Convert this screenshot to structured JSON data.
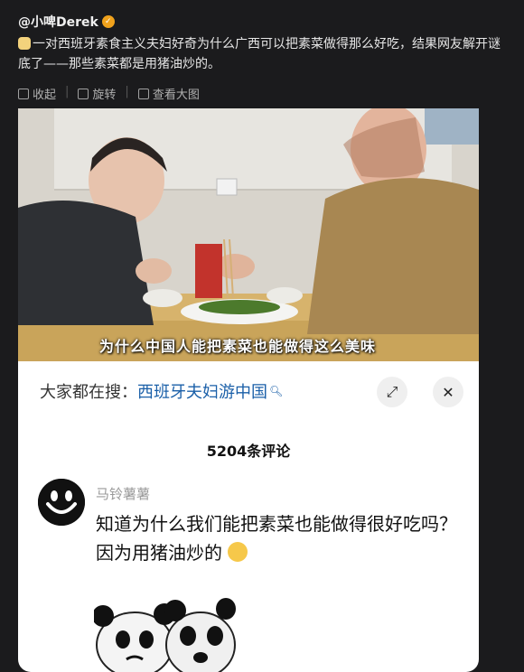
{
  "post": {
    "handle": "@小啤Derek",
    "text": "一对西班牙素食主义夫妇好奇为什么广西可以把素菜做得那么好吃，结果网友解开谜底了——那些素菜都是用猪油炒的。"
  },
  "actions": {
    "collect": "收起",
    "repost": "旋转",
    "view_large": "查看大图"
  },
  "photo": {
    "caption": "为什么中国人能把素菜也能做得这么美味"
  },
  "card": {
    "search_prefix": "大家都在搜：",
    "search_term": "西班牙夫妇游中国",
    "comment_count": "5204条评论",
    "comment": {
      "user": "马铃薯薯",
      "text": "知道为什么我们能把素菜也能做得很好吃吗？因为用猪油炒的"
    }
  },
  "colors": {
    "background": "#1b1b1d",
    "link": "#1a5fa8",
    "verified": "#f0a21c"
  },
  "icons": [
    "verified-icon",
    "collapse-icon",
    "rotate-icon",
    "view-large-icon",
    "search-icon",
    "expand-icon",
    "close-icon",
    "smile-emoji-icon"
  ]
}
